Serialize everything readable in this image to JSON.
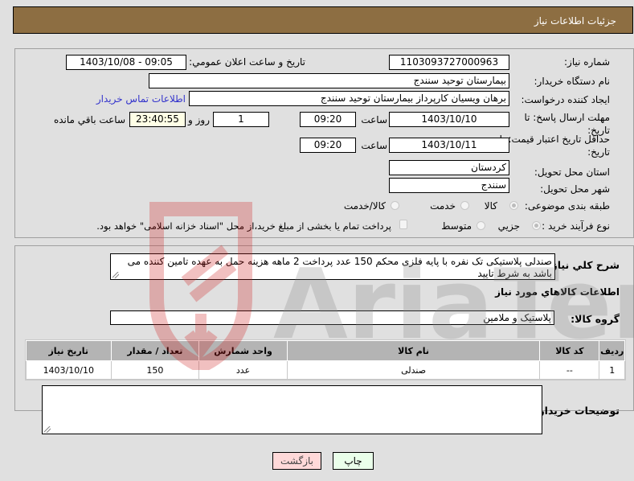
{
  "header": {
    "title": "جزئیات اطلاعات نیاز"
  },
  "fields": {
    "need_number": {
      "label": "شماره نیاز:",
      "value": "1103093727000963"
    },
    "announce_datetime": {
      "label": "تاریخ و ساعت اعلان عمومي:",
      "value": "1403/10/08 - 09:05"
    },
    "buyer_org": {
      "label": "نام دستگاه خریدار:",
      "value": "بیمارستان توحید سنندج"
    },
    "requester": {
      "label": "ایجاد کننده درخواست:",
      "value": "برهان ویسیان کارپرداز بیمارستان توحید سنندج"
    },
    "buyer_contact_link": "اطلاعات تماس خریدار",
    "reply_deadline": {
      "label": "مهلت ارسال پاسخ: تا تاریخ:",
      "date": "1403/10/10",
      "time_label": "ساعت",
      "time": "09:20",
      "days": "1",
      "days_label": "روز و",
      "remaining": "23:40:55",
      "remaining_label": "ساعت باقي مانده"
    },
    "price_validity": {
      "label": "حداقل تاریخ اعتبار قیمت: تا تاریخ:",
      "date": "1403/10/11",
      "time_label": "ساعت",
      "time": "09:20"
    },
    "province": {
      "label": "استان محل تحویل:",
      "value": "کردستان"
    },
    "city": {
      "label": "شهر محل تحویل:",
      "value": "سنندج"
    },
    "category": {
      "label": "طبقه بندی موضوعی:",
      "options": [
        "کالا",
        "خدمت",
        "کالا/خدمت"
      ],
      "selected": "کالا"
    },
    "purchase_type": {
      "label": "نوع فرآیند خرید :",
      "options": [
        "جزیي",
        "متوسط"
      ],
      "selected": "جزیي",
      "treasury_checkbox_label": "پرداخت تمام یا بخشی از مبلغ خرید،از محل \"اسناد خزانه اسلامی\" خواهد بود.",
      "treasury_checked": false
    }
  },
  "description": {
    "label": "شرح کلي نیاز:",
    "value": "صندلی پلاستیکی تک نفره با پایه فلزی محکم 150 عدد پرداخت 2 ماهه هزینه حمل به عهده تامین کننده  می باشد  به شرط تایید"
  },
  "goods_section_title": "اطلاعات کالاهاي مورد نیاز",
  "goods_group": {
    "label": "گروه کالا:",
    "value": "پلاستیک و ملامین"
  },
  "table": {
    "headers": [
      "ردیف",
      "کد کالا",
      "نام کالا",
      "واحد شمارش",
      "تعداد / مقدار",
      "تاریخ نیاز"
    ],
    "rows": [
      [
        "1",
        "--",
        "صندلی",
        "عدد",
        "150",
        "1403/10/10"
      ]
    ]
  },
  "buyer_notes": {
    "label": "توضیحات خریدار:",
    "value": ""
  },
  "buttons": {
    "print": "چاپ",
    "back": "بازگشت"
  },
  "colors": {
    "header_bg": "#8d6e42",
    "link": "#3333cc",
    "print_bg": "#eaffea",
    "back_bg": "#ffd9d9"
  },
  "watermark": "AriaTender.neT"
}
